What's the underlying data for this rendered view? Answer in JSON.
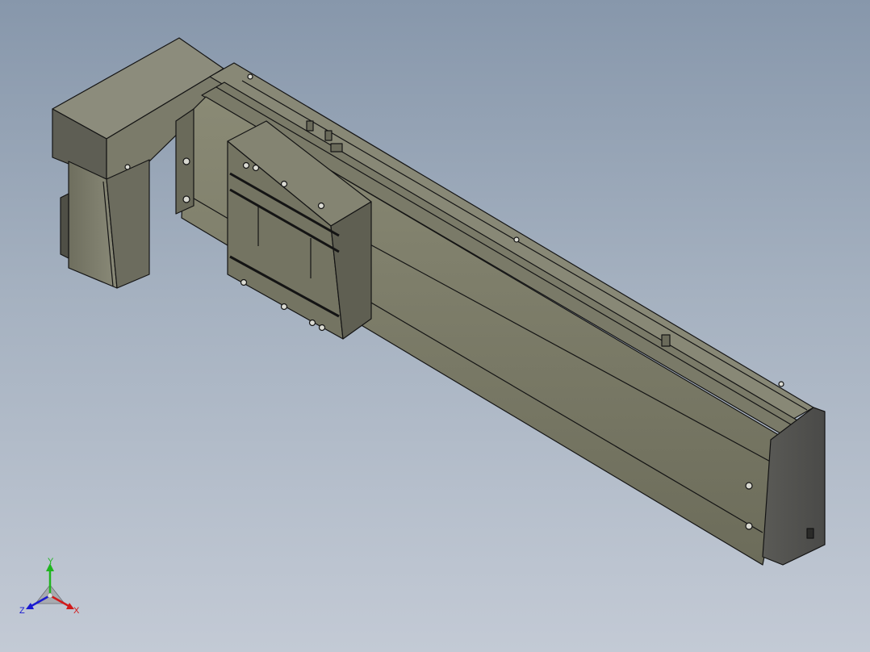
{
  "viewport": {
    "background_top": "#8797ab",
    "background_bottom": "#c3cad5",
    "model_face_color": "#7a7a66",
    "model_dark_color": "#5b5b4e",
    "model_light_color": "#8e8e7a",
    "edge_color": "#141414"
  },
  "triad": {
    "x_label": "X",
    "y_label": "Y",
    "z_label": "Z",
    "x_color": "#d11a1a",
    "y_color": "#1fb51f",
    "z_color": "#1a1ad1"
  }
}
